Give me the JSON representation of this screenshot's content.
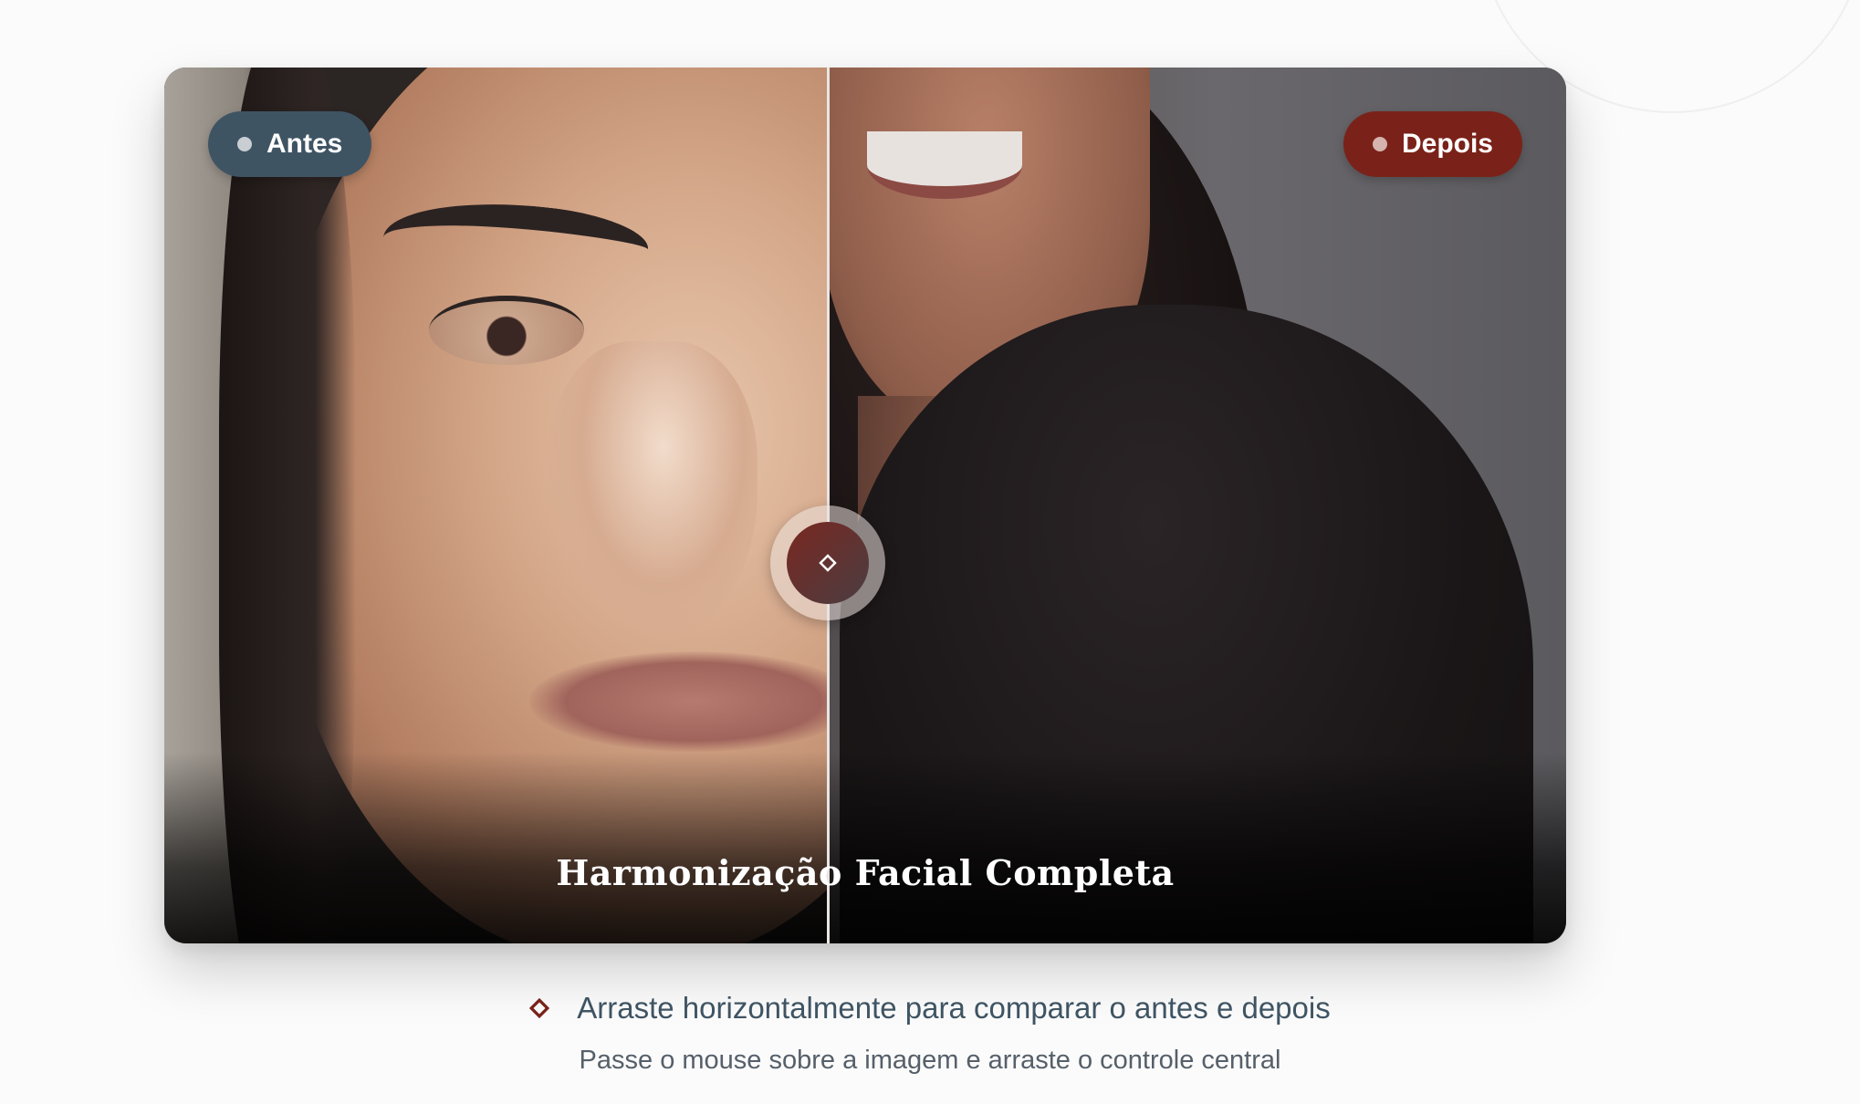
{
  "comparison": {
    "label_before": "Antes",
    "label_after": "Depois",
    "title": "Harmonização Facial Completa",
    "slider_position_percent": 47.3,
    "colors": {
      "before_badge": "#3f5463",
      "after_badge": "#7a2219",
      "handle_accent": "#7a2820"
    }
  },
  "instructions": {
    "primary": "Arraste horizontalmente para comparar o antes e depois",
    "secondary": "Passe o mouse sobre a imagem e arraste o controle central"
  },
  "icons": {
    "handle": "diamond-icon",
    "hint": "diamond-icon"
  }
}
